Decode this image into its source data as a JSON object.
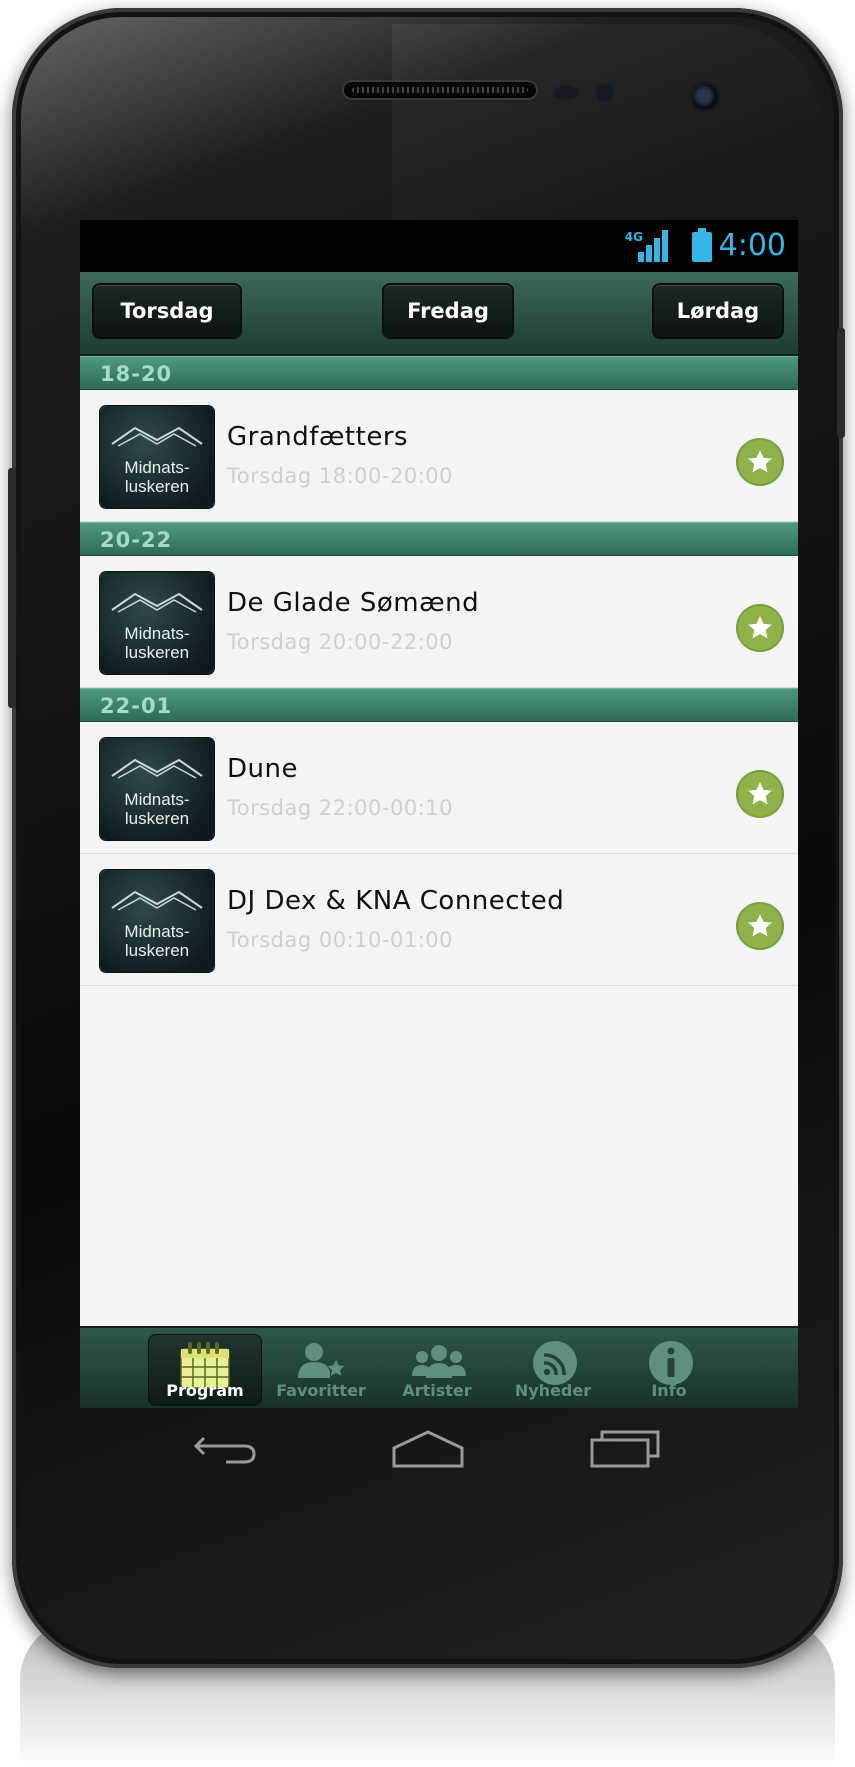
{
  "status_bar": {
    "network": "4G",
    "time": "4:00",
    "accent_color": "#33b5e5"
  },
  "days": [
    "Torsdag",
    "Fredag",
    "Lørdag"
  ],
  "slots": [
    {
      "header": "18-20",
      "events": [
        {
          "title": "Grandfætters",
          "time": "Torsdag 18:00-20:00",
          "thumb_text": [
            "Midnats-",
            "luskeren"
          ]
        }
      ]
    },
    {
      "header": "20-22",
      "events": [
        {
          "title": "De Glade Sømænd",
          "time": "Torsdag 20:00-22:00",
          "thumb_text": [
            "Midnats-",
            "luskeren"
          ]
        }
      ]
    },
    {
      "header": "22-01",
      "events": [
        {
          "title": "Dune",
          "time": "Torsdag 22:00-00:10",
          "thumb_text": [
            "Midnats-",
            "luskeren"
          ]
        },
        {
          "title": "DJ Dex & KNA Connected",
          "time": "Torsdag 00:10-01:00",
          "thumb_text": [
            "Midnats-",
            "luskeren"
          ]
        }
      ]
    }
  ],
  "tabs": [
    {
      "label": "Program",
      "icon": "calendar-icon",
      "active": true
    },
    {
      "label": "Favoritter",
      "icon": "person-star-icon",
      "active": false
    },
    {
      "label": "Artister",
      "icon": "people-icon",
      "active": false
    },
    {
      "label": "Nyheder",
      "icon": "rss-icon",
      "active": false
    },
    {
      "label": "Info",
      "icon": "info-icon",
      "active": false
    }
  ],
  "colors": {
    "header_green": "#3d6b5a",
    "slot_green": "#4e9a7e",
    "star_green": "#8fb24a"
  }
}
